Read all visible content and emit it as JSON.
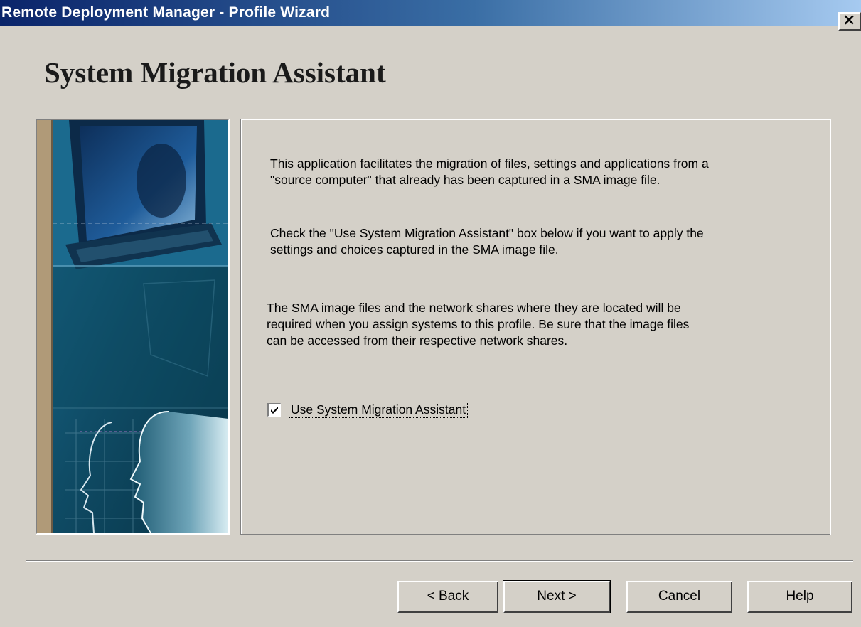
{
  "window": {
    "title": "Remote Deployment Manager - Profile Wizard",
    "close_glyph": "✕"
  },
  "page": {
    "heading": "System Migration Assistant"
  },
  "content": {
    "paragraph1": [
      "This application facilitates the migration of files, settings and applications from a",
      "\"source computer\" that already has been captured in a SMA image file."
    ],
    "paragraph2": [
      "Check the \"Use System Migration Assistant\" box below if you want to apply the",
      "settings and choices captured in the SMA image file."
    ],
    "paragraph3": [
      "The SMA image files and the network shares where they are located will be",
      "required when you assign systems to this profile.  Be sure that the image files",
      "can be accessed from their respective network shares."
    ],
    "checkbox": {
      "label": "Use System Migration Assistant",
      "checked": true
    }
  },
  "buttons": {
    "back": {
      "prefix": "< ",
      "accel": "B",
      "rest": "ack"
    },
    "next": {
      "accel": "N",
      "rest": "ext >"
    },
    "cancel": "Cancel",
    "help": "Help"
  }
}
